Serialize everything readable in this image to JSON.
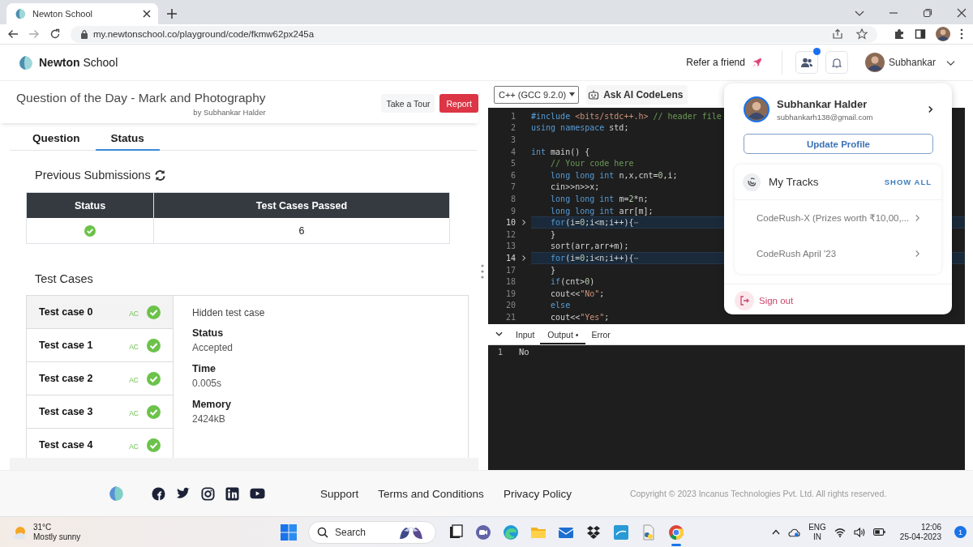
{
  "browser": {
    "tab_title": "Newton School",
    "url": "my.newtonschool.co/playground/code/fkmw62px245a"
  },
  "header": {
    "brand_bold": "Newton",
    "brand_rest": "School",
    "refer": "Refer a friend",
    "people_badge": true,
    "user": "Subhankar"
  },
  "question": {
    "title": "Question of the Day - Mark and Photography",
    "author": "by Subhankar Halder",
    "buttons": [
      {
        "label": "Take a Tour",
        "kind": "plain"
      },
      {
        "label": "Report",
        "kind": "danger"
      }
    ]
  },
  "tabs": [
    {
      "label": "Question",
      "selected": false
    },
    {
      "label": "Status",
      "selected": true
    }
  ],
  "submissions": {
    "heading": "Previous Submissions",
    "columns": [
      "Status",
      "Test Cases Passed"
    ],
    "rows": [
      {
        "passed": true,
        "count": "6"
      }
    ]
  },
  "test_cases": {
    "heading": "Test Cases",
    "items": [
      {
        "label": "Test case 0",
        "verdict": "AC",
        "passed": true,
        "selected": true
      },
      {
        "label": "Test case 1",
        "verdict": "AC",
        "passed": true,
        "selected": false
      },
      {
        "label": "Test case 2",
        "verdict": "AC",
        "passed": true,
        "selected": false
      },
      {
        "label": "Test case 3",
        "verdict": "AC",
        "passed": true,
        "selected": false
      },
      {
        "label": "Test case 4",
        "verdict": "AC",
        "passed": true,
        "selected": false
      }
    ],
    "detail": {
      "title": "Hidden test case",
      "fields": [
        {
          "label": "Status",
          "value": "Accepted"
        },
        {
          "label": "Time",
          "value": "0.005s"
        },
        {
          "label": "Memory",
          "value": "2424kB"
        }
      ]
    }
  },
  "editor": {
    "language": "C++ (GCC 9.2.0)",
    "assist": "Ask AI CodeLens",
    "lines": [
      {
        "number": "1",
        "folded": false,
        "highlighted": false,
        "tokens": [
          {
            "kind": "keyword",
            "text": "#include "
          },
          {
            "kind": "string",
            "text": "<bits/stdc++.h>"
          },
          {
            "kind": "comment",
            "text": " // header file"
          }
        ]
      },
      {
        "number": "2",
        "folded": false,
        "highlighted": false,
        "tokens": [
          {
            "kind": "keyword",
            "text": "using namespace"
          },
          {
            "kind": "plain",
            "text": " std;"
          }
        ]
      },
      {
        "number": "3",
        "folded": false,
        "highlighted": false
      },
      {
        "number": "4",
        "folded": false,
        "highlighted": false,
        "tokens": [
          {
            "kind": "keyword",
            "text": "int"
          },
          {
            "kind": "plain",
            "text": " main() {"
          }
        ]
      },
      {
        "number": "5",
        "folded": false,
        "highlighted": false,
        "tokens": [
          {
            "kind": "comment",
            "text": "    // Your code here"
          }
        ]
      },
      {
        "number": "6",
        "folded": false,
        "highlighted": false,
        "tokens": [
          {
            "kind": "keyword",
            "text": "    long long int"
          },
          {
            "kind": "plain",
            "text": " n,x,cnt="
          },
          {
            "kind": "number",
            "text": "0"
          },
          {
            "kind": "plain",
            "text": ",i;"
          }
        ]
      },
      {
        "number": "7",
        "folded": false,
        "highlighted": false,
        "tokens": [
          {
            "kind": "plain",
            "text": "    cin>>n>>x;"
          }
        ]
      },
      {
        "number": "8",
        "folded": false,
        "highlighted": false,
        "tokens": [
          {
            "kind": "keyword",
            "text": "    long long int"
          },
          {
            "kind": "plain",
            "text": " m="
          },
          {
            "kind": "number",
            "text": "2"
          },
          {
            "kind": "plain",
            "text": "*n;"
          }
        ]
      },
      {
        "number": "9",
        "folded": false,
        "highlighted": false,
        "tokens": [
          {
            "kind": "keyword",
            "text": "    long long int"
          },
          {
            "kind": "plain",
            "text": " arr[m];"
          }
        ]
      },
      {
        "number": "10",
        "folded": true,
        "highlighted": true,
        "tokens": [
          {
            "kind": "keyword",
            "text": "    for"
          },
          {
            "kind": "plain",
            "text": "(i="
          },
          {
            "kind": "number",
            "text": "0"
          },
          {
            "kind": "plain",
            "text": ";i<m;i++){"
          },
          {
            "kind": "fold",
            "text": "⋯"
          }
        ]
      },
      {
        "number": "12",
        "folded": false,
        "highlighted": false,
        "tokens": [
          {
            "kind": "plain",
            "text": "    }"
          }
        ]
      },
      {
        "number": "13",
        "folded": false,
        "highlighted": false,
        "tokens": [
          {
            "kind": "plain",
            "text": "    sort(arr,arr+m);"
          }
        ]
      },
      {
        "number": "14",
        "folded": true,
        "highlighted": true,
        "tokens": [
          {
            "kind": "keyword",
            "text": "    for"
          },
          {
            "kind": "plain",
            "text": "(i="
          },
          {
            "kind": "number",
            "text": "0"
          },
          {
            "kind": "plain",
            "text": ";i<n;i++){"
          },
          {
            "kind": "fold",
            "text": "⋯"
          }
        ]
      },
      {
        "number": "17",
        "folded": false,
        "highlighted": false,
        "tokens": [
          {
            "kind": "plain",
            "text": "    }"
          }
        ]
      },
      {
        "number": "18",
        "folded": false,
        "highlighted": false,
        "tokens": [
          {
            "kind": "keyword",
            "text": "    if"
          },
          {
            "kind": "plain",
            "text": "(cnt>"
          },
          {
            "kind": "number",
            "text": "0"
          },
          {
            "kind": "plain",
            "text": ")"
          }
        ]
      },
      {
        "number": "19",
        "folded": false,
        "highlighted": false,
        "tokens": [
          {
            "kind": "plain",
            "text": "    cout<<"
          },
          {
            "kind": "string",
            "text": "\"No\""
          },
          {
            "kind": "plain",
            "text": ";"
          }
        ]
      },
      {
        "number": "20",
        "folded": false,
        "highlighted": false,
        "tokens": [
          {
            "kind": "keyword",
            "text": "    else"
          }
        ]
      },
      {
        "number": "21",
        "folded": false,
        "highlighted": false,
        "tokens": [
          {
            "kind": "plain",
            "text": "    cout<<"
          },
          {
            "kind": "string",
            "text": "\"Yes\""
          },
          {
            "kind": "plain",
            "text": ";"
          }
        ]
      }
    ]
  },
  "output": {
    "tabs": [
      {
        "label": "Input",
        "selected": false
      },
      {
        "label": "Output •",
        "selected": true
      },
      {
        "label": "Error",
        "selected": false
      }
    ],
    "lines": [
      {
        "number": "1",
        "text": "No"
      }
    ]
  },
  "profile_menu": {
    "name": "Subhankar Halder",
    "email": "subhankarh138@gmail.com",
    "update": "Update Profile",
    "tracks_title": "My Tracks",
    "show_all": "SHOW ALL",
    "tracks": [
      "CodeRush-X (Prizes worth ₹10,00,...",
      "CodeRush April '23"
    ],
    "sign_out": "Sign out"
  },
  "footer": {
    "links": [
      "Support",
      "Terms and Conditions",
      "Privacy Policy"
    ],
    "copyright": "Copyright © 2023 Incanus Technologies Pvt. Ltd. All rights reserved."
  },
  "taskbar": {
    "temperature": "31°C",
    "weather": "Mostly sunny",
    "search": "Search",
    "apps": [
      {
        "kind": "taskview",
        "active": false
      },
      {
        "kind": "chat",
        "active": false
      },
      {
        "kind": "edge",
        "active": false
      },
      {
        "kind": "files",
        "active": false
      },
      {
        "kind": "mail",
        "active": false
      },
      {
        "kind": "dropbox",
        "active": false
      },
      {
        "kind": "blueapp",
        "active": false
      },
      {
        "kind": "document",
        "active": false
      },
      {
        "kind": "chrome",
        "active": true
      }
    ],
    "language": "ENG",
    "region": "IN",
    "time": "12:06",
    "date": "25-04-2023",
    "notifications": "1"
  }
}
